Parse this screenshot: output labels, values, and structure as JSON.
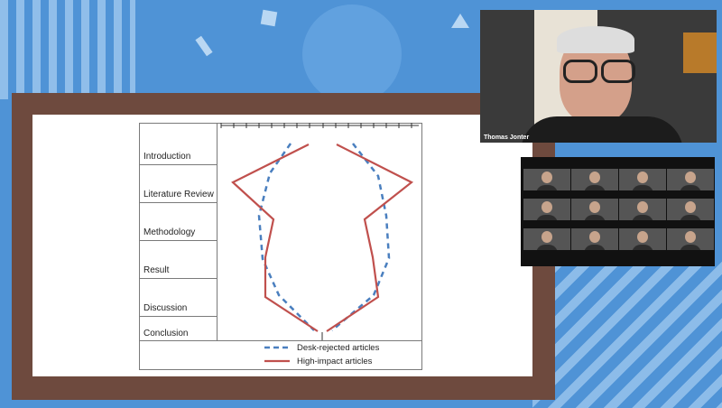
{
  "chart_data": {
    "type": "line",
    "rows": [
      "Introduction",
      "Literature Review",
      "Methodology",
      "Result",
      "Discussion",
      "Conclusion"
    ],
    "series": [
      {
        "name": "Desk-rejected articles",
        "style": "dashed",
        "color": "#4a7fbf"
      },
      {
        "name": "High-impact articles",
        "style": "solid",
        "color": "#c0504d"
      }
    ],
    "legend_position": "bottom"
  },
  "video": {
    "speaker_name": "Thomas Jonter"
  },
  "colors": {
    "background": "#4f93d6",
    "frame": "#6e4a3e",
    "desk_rejected": "#4a7fbf",
    "high_impact": "#c0504d"
  }
}
